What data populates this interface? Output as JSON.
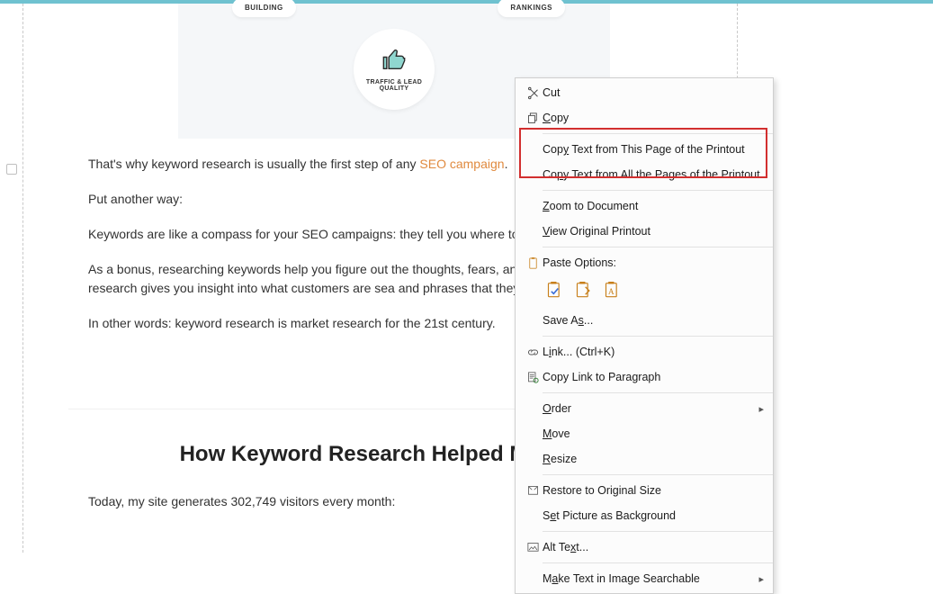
{
  "hero": {
    "left_pill": "BUILDING",
    "right_pill": "RANKINGS",
    "center_label": "TRAFFIC & LEAD\nQUALITY"
  },
  "article": {
    "p1_a": "That's why keyword research is usually the first step of any ",
    "p1_link": "SEO campaign",
    "p1_b": ".",
    "p2": "Put another way:",
    "p3": "Keywords are like a compass for your SEO campaigns: they tell you where to go progress.",
    "p4": "As a bonus, researching keywords help you figure out the thoughts, fears, and d That's because keyword research gives you insight into what customers are sea and phrases that they use.",
    "p5": "In other words: keyword research is market research for the 21st century."
  },
  "panel2": {
    "heading": "How Keyword Research Helped My Site",
    "para": "Today, my site generates 302,749 visitors every month:"
  },
  "menu": {
    "cut": "Cut",
    "copy": "Copy",
    "copy_page": "Copy Text from This Page of the Printout",
    "copy_all": "Copy Text from All the Pages of the Printout",
    "zoom": "Zoom to Document",
    "view_orig": "View Original Printout",
    "paste_heading": "Paste Options:",
    "save_as": "Save As...",
    "link": "Link...  (Ctrl+K)",
    "copy_link_para": "Copy Link to Paragraph",
    "order": "Order",
    "move": "Move",
    "resize": "Resize",
    "restore": "Restore to Original Size",
    "set_bg": "Set Picture as Background",
    "alt_text": "Alt Text...",
    "make_search": "Make Text in Image Searchable"
  }
}
